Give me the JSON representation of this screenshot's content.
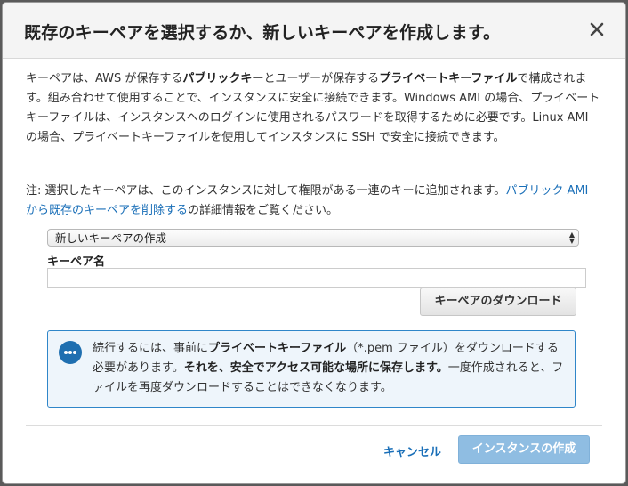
{
  "dialog": {
    "title": "既存のキーペアを選択するか、新しいキーペアを作成します。",
    "close_icon": "close-icon"
  },
  "description": {
    "p1_a": "キーペアは、AWS が保存する",
    "p1_b": "パブリックキー",
    "p1_c": "とユーザーが保存する",
    "p1_d": "プライベートキーファイル",
    "p1_e": "で構成されます。組み合わせて使用することで、インスタンスに安全に接続できます。Windows AMI の場合、プライベートキーファイルは、インスタンスへのログインに使用されるパスワードを取得するために必要です。Linux AMI の場合、プライベートキーファイルを使用してインスタンスに SSH で安全に接続できます。"
  },
  "note": {
    "text_a": "注: 選択したキーペアは、このインスタンスに対して権限がある一連のキーに追加されます。",
    "link": "パブリック AMI から既存のキーペアを削除する",
    "text_b": "の詳細情報をご覧ください。"
  },
  "keypair_select": {
    "selected": "新しいキーペアの作成"
  },
  "keypair_name": {
    "label": "キーペア名",
    "value": "",
    "placeholder": ""
  },
  "download_button": {
    "label": "キーペアのダウンロード"
  },
  "info": {
    "icon": "chat-bubble-icon",
    "text_a": "続行するには、事前に",
    "text_b": "プライベートキーファイル",
    "text_c": "（*.pem ファイル）をダウンロードする必要があります。",
    "text_d": "それを、安全でアクセス可能な場所に保存します。",
    "text_e": "一度作成されると、ファイルを再度ダウンロードすることはできなくなります。"
  },
  "footer": {
    "cancel_label": "キャンセル",
    "launch_label": "インスタンスの作成"
  },
  "colors": {
    "link": "#1a6fb8",
    "info_border": "#2f86c9",
    "info_bg": "#eef5fb",
    "primary_disabled": "#8fbde2"
  }
}
